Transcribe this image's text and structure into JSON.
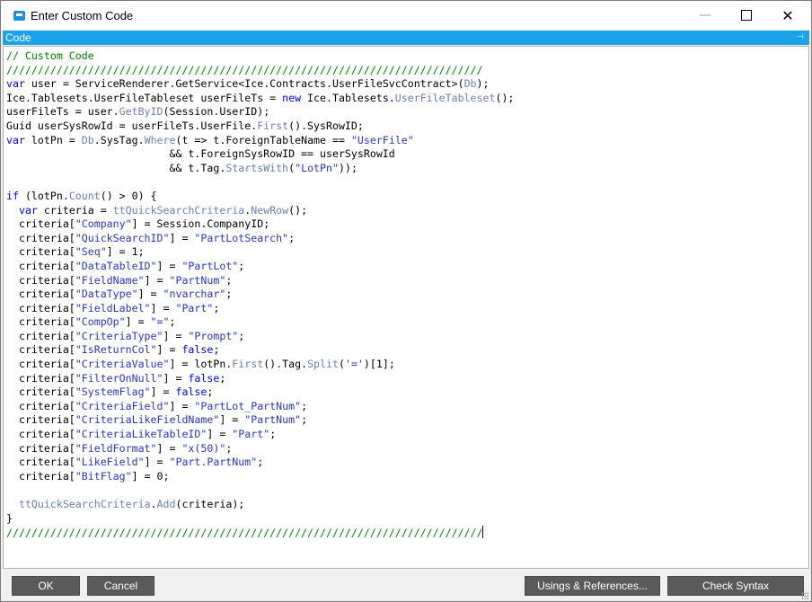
{
  "window": {
    "title": "Enter Custom Code",
    "icon": "app-window-icon",
    "minimize_glyph": "—",
    "close_glyph": "✕"
  },
  "panel": {
    "title": "Code",
    "pin_glyph": "⊣"
  },
  "colors": {
    "panel_bar": "#1aa3e8",
    "comment": "#008000",
    "keyword": "#0000ff",
    "string": "#2a35c4",
    "button_bg": "#5a5a5a"
  },
  "code_lines": [
    [
      {
        "t": "// Custom Code",
        "c": "comment"
      }
    ],
    [
      {
        "t": "////////////////////////////////////////////////////////////////////////////",
        "c": "comment"
      }
    ],
    [
      {
        "t": "var",
        "c": "keyword"
      },
      {
        "t": " user = ServiceRenderer.GetService<Ice.Contracts.UserFileSvcContract>(",
        "c": "plain"
      },
      {
        "t": "Db",
        "c": "method"
      },
      {
        "t": ");",
        "c": "plain"
      }
    ],
    [
      {
        "t": "Ice.Tablesets.UserFileTableset userFileTs = ",
        "c": "plain"
      },
      {
        "t": "new",
        "c": "keyword"
      },
      {
        "t": " Ice.Tablesets.",
        "c": "plain"
      },
      {
        "t": "UserFileTableset",
        "c": "method"
      },
      {
        "t": "();",
        "c": "plain"
      }
    ],
    [
      {
        "t": "userFileTs = user.",
        "c": "plain"
      },
      {
        "t": "GetByID",
        "c": "method"
      },
      {
        "t": "(Session.UserID);",
        "c": "plain"
      }
    ],
    [
      {
        "t": "Guid userSysRowId = userFileTs.UserFile.",
        "c": "plain"
      },
      {
        "t": "First",
        "c": "method"
      },
      {
        "t": "().SysRowID;",
        "c": "plain"
      }
    ],
    [
      {
        "t": "var",
        "c": "keyword"
      },
      {
        "t": " lotPn = ",
        "c": "plain"
      },
      {
        "t": "Db",
        "c": "method"
      },
      {
        "t": ".SysTag.",
        "c": "plain"
      },
      {
        "t": "Where",
        "c": "method"
      },
      {
        "t": "(t => t.ForeignTableName == ",
        "c": "plain"
      },
      {
        "t": "\"UserFile\"",
        "c": "string"
      }
    ],
    [
      {
        "t": "                          && t.ForeignSysRowID == userSysRowId",
        "c": "plain"
      }
    ],
    [
      {
        "t": "                          && t.Tag.",
        "c": "plain"
      },
      {
        "t": "StartsWith",
        "c": "method"
      },
      {
        "t": "(",
        "c": "plain"
      },
      {
        "t": "\"LotPn\"",
        "c": "string"
      },
      {
        "t": "));",
        "c": "plain"
      }
    ],
    [],
    [
      {
        "t": "if",
        "c": "keyword"
      },
      {
        "t": " (lotPn.",
        "c": "plain"
      },
      {
        "t": "Count",
        "c": "method"
      },
      {
        "t": "() > 0) {",
        "c": "plain"
      }
    ],
    [
      {
        "t": "  ",
        "c": "plain"
      },
      {
        "t": "var",
        "c": "keyword"
      },
      {
        "t": " criteria = ",
        "c": "plain"
      },
      {
        "t": "ttQuickSearchCriteria",
        "c": "method"
      },
      {
        "t": ".",
        "c": "plain"
      },
      {
        "t": "NewRow",
        "c": "method"
      },
      {
        "t": "();",
        "c": "plain"
      }
    ],
    [
      {
        "t": "  criteria[",
        "c": "plain"
      },
      {
        "t": "\"Company\"",
        "c": "string"
      },
      {
        "t": "] = Session.CompanyID;",
        "c": "plain"
      }
    ],
    [
      {
        "t": "  criteria[",
        "c": "plain"
      },
      {
        "t": "\"QuickSearchID\"",
        "c": "string"
      },
      {
        "t": "] = ",
        "c": "plain"
      },
      {
        "t": "\"PartLotSearch\"",
        "c": "string"
      },
      {
        "t": ";",
        "c": "plain"
      }
    ],
    [
      {
        "t": "  criteria[",
        "c": "plain"
      },
      {
        "t": "\"Seq\"",
        "c": "string"
      },
      {
        "t": "] = 1;",
        "c": "plain"
      }
    ],
    [
      {
        "t": "  criteria[",
        "c": "plain"
      },
      {
        "t": "\"DataTableID\"",
        "c": "string"
      },
      {
        "t": "] = ",
        "c": "plain"
      },
      {
        "t": "\"PartLot\"",
        "c": "string"
      },
      {
        "t": ";",
        "c": "plain"
      }
    ],
    [
      {
        "t": "  criteria[",
        "c": "plain"
      },
      {
        "t": "\"FieldName\"",
        "c": "string"
      },
      {
        "t": "] = ",
        "c": "plain"
      },
      {
        "t": "\"PartNum\"",
        "c": "string"
      },
      {
        "t": ";",
        "c": "plain"
      }
    ],
    [
      {
        "t": "  criteria[",
        "c": "plain"
      },
      {
        "t": "\"DataType\"",
        "c": "string"
      },
      {
        "t": "] = ",
        "c": "plain"
      },
      {
        "t": "\"nvarchar\"",
        "c": "string"
      },
      {
        "t": ";",
        "c": "plain"
      }
    ],
    [
      {
        "t": "  criteria[",
        "c": "plain"
      },
      {
        "t": "\"FieldLabel\"",
        "c": "string"
      },
      {
        "t": "] = ",
        "c": "plain"
      },
      {
        "t": "\"Part\"",
        "c": "string"
      },
      {
        "t": ";",
        "c": "plain"
      }
    ],
    [
      {
        "t": "  criteria[",
        "c": "plain"
      },
      {
        "t": "\"CompOp\"",
        "c": "string"
      },
      {
        "t": "] = ",
        "c": "plain"
      },
      {
        "t": "\"=\"",
        "c": "string"
      },
      {
        "t": ";",
        "c": "plain"
      }
    ],
    [
      {
        "t": "  criteria[",
        "c": "plain"
      },
      {
        "t": "\"CriteriaType\"",
        "c": "string"
      },
      {
        "t": "] = ",
        "c": "plain"
      },
      {
        "t": "\"Prompt\"",
        "c": "string"
      },
      {
        "t": ";",
        "c": "plain"
      }
    ],
    [
      {
        "t": "  criteria[",
        "c": "plain"
      },
      {
        "t": "\"IsReturnCol\"",
        "c": "string"
      },
      {
        "t": "] = ",
        "c": "plain"
      },
      {
        "t": "false",
        "c": "keyword"
      },
      {
        "t": ";",
        "c": "plain"
      }
    ],
    [
      {
        "t": "  criteria[",
        "c": "plain"
      },
      {
        "t": "\"CriteriaValue\"",
        "c": "string"
      },
      {
        "t": "] = lotPn.",
        "c": "plain"
      },
      {
        "t": "First",
        "c": "method"
      },
      {
        "t": "().Tag.",
        "c": "plain"
      },
      {
        "t": "Split",
        "c": "method"
      },
      {
        "t": "(",
        "c": "plain"
      },
      {
        "t": "'='",
        "c": "string"
      },
      {
        "t": ")[1];",
        "c": "plain"
      }
    ],
    [
      {
        "t": "  criteria[",
        "c": "plain"
      },
      {
        "t": "\"FilterOnNull\"",
        "c": "string"
      },
      {
        "t": "] = ",
        "c": "plain"
      },
      {
        "t": "false",
        "c": "keyword"
      },
      {
        "t": ";",
        "c": "plain"
      }
    ],
    [
      {
        "t": "  criteria[",
        "c": "plain"
      },
      {
        "t": "\"SystemFlag\"",
        "c": "string"
      },
      {
        "t": "] = ",
        "c": "plain"
      },
      {
        "t": "false",
        "c": "keyword"
      },
      {
        "t": ";",
        "c": "plain"
      }
    ],
    [
      {
        "t": "  criteria[",
        "c": "plain"
      },
      {
        "t": "\"CriteriaField\"",
        "c": "string"
      },
      {
        "t": "] = ",
        "c": "plain"
      },
      {
        "t": "\"PartLot_PartNum\"",
        "c": "string"
      },
      {
        "t": ";",
        "c": "plain"
      }
    ],
    [
      {
        "t": "  criteria[",
        "c": "plain"
      },
      {
        "t": "\"CriteriaLikeFieldName\"",
        "c": "string"
      },
      {
        "t": "] = ",
        "c": "plain"
      },
      {
        "t": "\"PartNum\"",
        "c": "string"
      },
      {
        "t": ";",
        "c": "plain"
      }
    ],
    [
      {
        "t": "  criteria[",
        "c": "plain"
      },
      {
        "t": "\"CriteriaLikeTableID\"",
        "c": "string"
      },
      {
        "t": "] = ",
        "c": "plain"
      },
      {
        "t": "\"Part\"",
        "c": "string"
      },
      {
        "t": ";",
        "c": "plain"
      }
    ],
    [
      {
        "t": "  criteria[",
        "c": "plain"
      },
      {
        "t": "\"FieldFormat\"",
        "c": "string"
      },
      {
        "t": "] = ",
        "c": "plain"
      },
      {
        "t": "\"x(50)\"",
        "c": "string"
      },
      {
        "t": ";",
        "c": "plain"
      }
    ],
    [
      {
        "t": "  criteria[",
        "c": "plain"
      },
      {
        "t": "\"LikeField\"",
        "c": "string"
      },
      {
        "t": "] = ",
        "c": "plain"
      },
      {
        "t": "\"Part.PartNum\"",
        "c": "string"
      },
      {
        "t": ";",
        "c": "plain"
      }
    ],
    [
      {
        "t": "  criteria[",
        "c": "plain"
      },
      {
        "t": "\"BitFlag\"",
        "c": "string"
      },
      {
        "t": "] = 0;",
        "c": "plain"
      }
    ],
    [],
    [
      {
        "t": "  ",
        "c": "plain"
      },
      {
        "t": "ttQuickSearchCriteria",
        "c": "method"
      },
      {
        "t": ".",
        "c": "plain"
      },
      {
        "t": "Add",
        "c": "method"
      },
      {
        "t": "(criteria);",
        "c": "plain"
      }
    ],
    [
      {
        "t": "}",
        "c": "plain"
      }
    ],
    [
      {
        "t": "////////////////////////////////////////////////////////////////////////////",
        "c": "comment"
      }
    ]
  ],
  "buttons": {
    "ok": "OK",
    "cancel": "Cancel",
    "usings": "Usings & References...",
    "check_syntax": "Check Syntax"
  }
}
